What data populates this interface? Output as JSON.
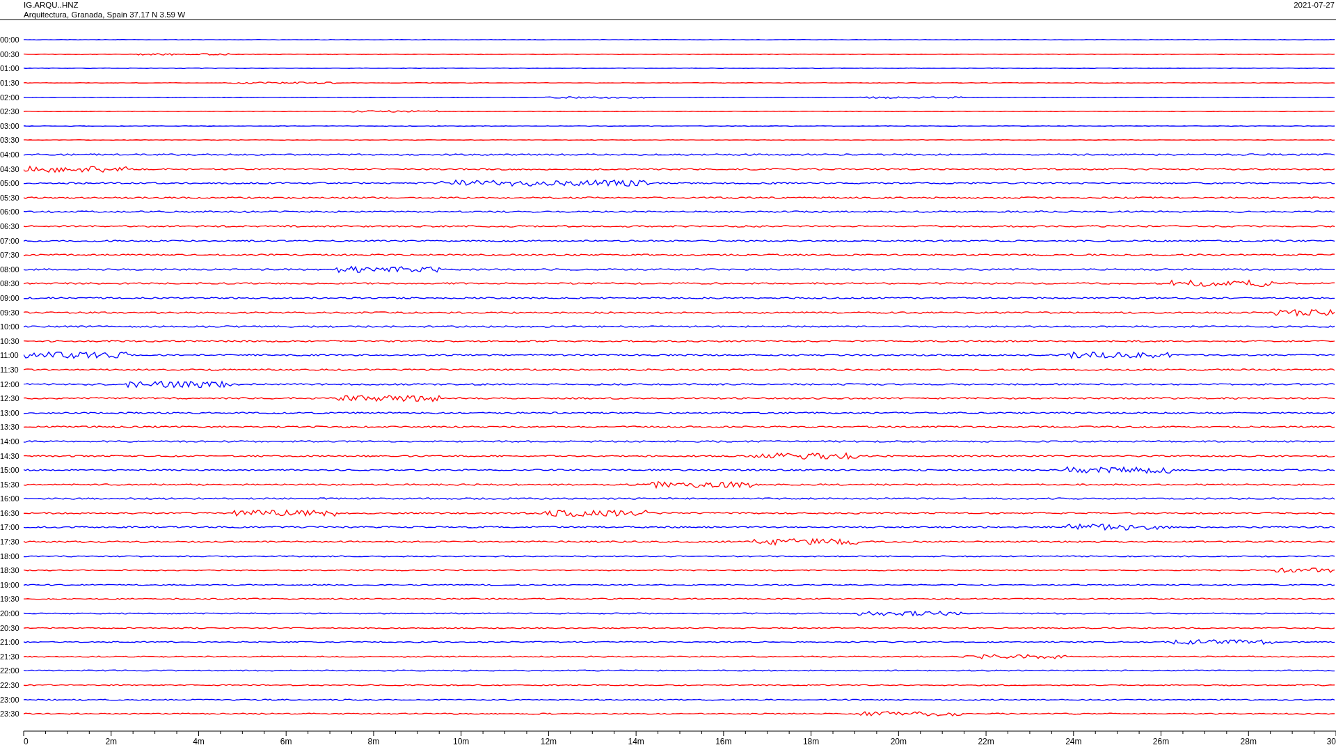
{
  "header": {
    "station": "IG.ARQU..HNZ",
    "location": "Arquitectura, Granada, Spain  37.17 N 3.59 W",
    "date": "2021-07-27"
  },
  "rows": [
    {
      "time": "00:00",
      "color": "#0000ff"
    },
    {
      "time": "00:30",
      "color": "#ff0000"
    },
    {
      "time": "01:00",
      "color": "#0000ff"
    },
    {
      "time": "01:30",
      "color": "#ff0000"
    },
    {
      "time": "02:00",
      "color": "#0000ff"
    },
    {
      "time": "02:30",
      "color": "#ff0000"
    },
    {
      "time": "03:00",
      "color": "#0000ff"
    },
    {
      "time": "03:30",
      "color": "#ff0000"
    },
    {
      "time": "04:00",
      "color": "#0000ff"
    },
    {
      "time": "04:30",
      "color": "#ff0000"
    },
    {
      "time": "05:00",
      "color": "#0000ff"
    },
    {
      "time": "05:30",
      "color": "#ff0000"
    },
    {
      "time": "06:00",
      "color": "#0000ff"
    },
    {
      "time": "06:30",
      "color": "#ff0000"
    },
    {
      "time": "07:00",
      "color": "#0000ff"
    },
    {
      "time": "07:30",
      "color": "#ff0000"
    },
    {
      "time": "08:00",
      "color": "#0000ff"
    },
    {
      "time": "08:30",
      "color": "#ff0000"
    },
    {
      "time": "09:00",
      "color": "#0000ff"
    },
    {
      "time": "09:30",
      "color": "#ff0000"
    },
    {
      "time": "10:00",
      "color": "#0000ff"
    },
    {
      "time": "10:30",
      "color": "#ff0000"
    },
    {
      "time": "11:00",
      "color": "#0000ff"
    },
    {
      "time": "11:30",
      "color": "#ff0000"
    },
    {
      "time": "12:00",
      "color": "#0000ff"
    },
    {
      "time": "12:30",
      "color": "#ff0000"
    },
    {
      "time": "13:00",
      "color": "#0000ff"
    },
    {
      "time": "13:30",
      "color": "#ff0000"
    },
    {
      "time": "14:00",
      "color": "#0000ff"
    },
    {
      "time": "14:30",
      "color": "#ff0000"
    },
    {
      "time": "15:00",
      "color": "#0000ff"
    },
    {
      "time": "15:30",
      "color": "#ff0000"
    },
    {
      "time": "16:00",
      "color": "#0000ff"
    },
    {
      "time": "16:30",
      "color": "#ff0000"
    },
    {
      "time": "17:00",
      "color": "#0000ff"
    },
    {
      "time": "17:30",
      "color": "#ff0000"
    },
    {
      "time": "18:00",
      "color": "#0000ff"
    },
    {
      "time": "18:30",
      "color": "#ff0000"
    },
    {
      "time": "19:00",
      "color": "#0000ff"
    },
    {
      "time": "19:30",
      "color": "#ff0000"
    },
    {
      "time": "20:00",
      "color": "#0000ff"
    },
    {
      "time": "20:30",
      "color": "#ff0000"
    },
    {
      "time": "21:00",
      "color": "#0000ff"
    },
    {
      "time": "21:30",
      "color": "#ff0000"
    },
    {
      "time": "22:00",
      "color": "#0000ff"
    },
    {
      "time": "22:30",
      "color": "#ff0000"
    },
    {
      "time": "23:00",
      "color": "#0000ff"
    },
    {
      "time": "23:30",
      "color": "#ff0000"
    }
  ],
  "x_axis": {
    "labels": [
      "0",
      "2m",
      "4m",
      "6m",
      "8m",
      "10m",
      "12m",
      "14m",
      "16m",
      "18m",
      "20m",
      "22m",
      "24m",
      "26m",
      "28m",
      "30"
    ]
  }
}
